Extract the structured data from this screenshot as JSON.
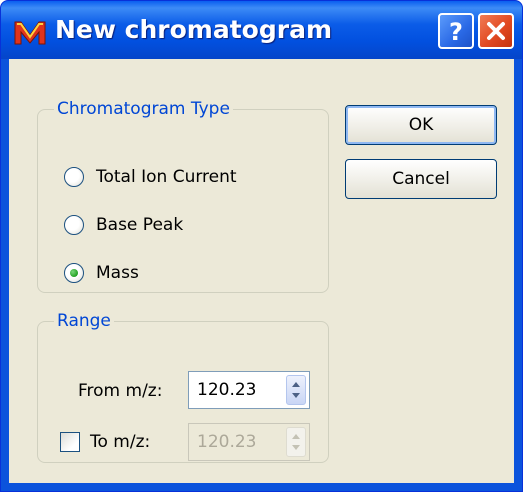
{
  "window": {
    "title": "New chromatogram",
    "help_icon": "question-mark",
    "close_icon": "close-x"
  },
  "chromatogram_type": {
    "legend": "Chromatogram Type",
    "options": [
      {
        "label": "Total Ion Current",
        "checked": false
      },
      {
        "label": "Base Peak",
        "checked": false
      },
      {
        "label": "Mass",
        "checked": true
      }
    ]
  },
  "range": {
    "legend": "Range",
    "from_label": "From m/z:",
    "from_value": "120.23",
    "to_label": "To m/z:",
    "to_value": "120.23",
    "to_enabled": false
  },
  "buttons": {
    "ok": "OK",
    "cancel": "Cancel"
  },
  "colors": {
    "titlebar": "#0b53dc",
    "dialog_bg": "#ece9d8",
    "group_legend": "#0046d5",
    "close_button": "#e24a22"
  }
}
